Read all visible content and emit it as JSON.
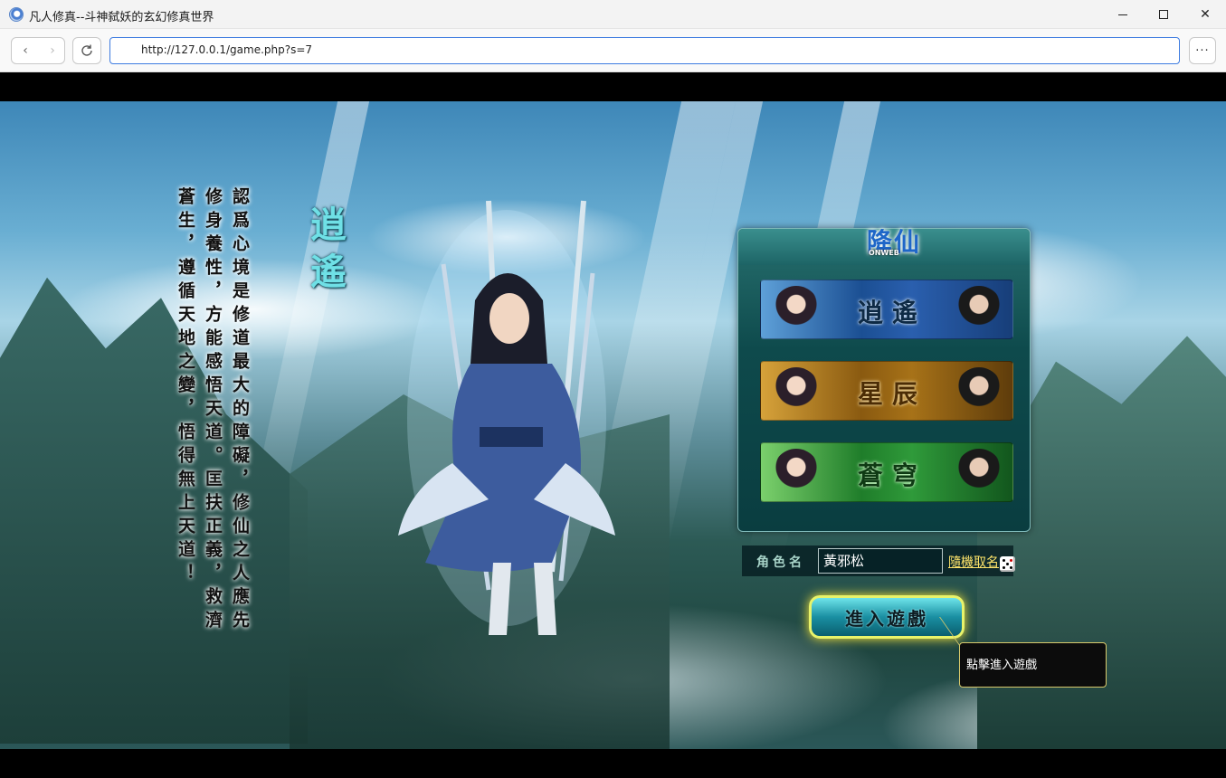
{
  "window": {
    "title": "凡人修真--斗神弑妖的玄幻修真世界",
    "minimize_glyph": "—",
    "maximize_glyph": "☐",
    "close_glyph": "✕"
  },
  "browser": {
    "back_glyph": "‹",
    "forward_glyph": "›",
    "reload_glyph": "↻",
    "url": "http://127.0.0.1/game.php?s=7",
    "more_glyph": "···"
  },
  "game": {
    "poem_title": "逍遙",
    "poem_text": "認爲心境是修道最大的障礙，修仙之人應先修身養性，方能感悟天道。匡扶正義，救濟蒼生，遵循天地之變，悟得無上天道！",
    "logo": {
      "text": "降仙",
      "sub": "ONWEB"
    },
    "factions": [
      {
        "name": "逍遙",
        "color": "#2a5fae"
      },
      {
        "name": "星辰",
        "color": "#a77218"
      },
      {
        "name": "蒼穹",
        "color": "#2f9a3a"
      }
    ],
    "name_label": "角色名",
    "name_value": "黃邪松",
    "random_name_link": "隨機取名",
    "enter_button": "進入遊戲",
    "tooltip": "點擊進入遊戲",
    "icons": {
      "dice": "dice-icon",
      "app": "app-icon"
    }
  }
}
